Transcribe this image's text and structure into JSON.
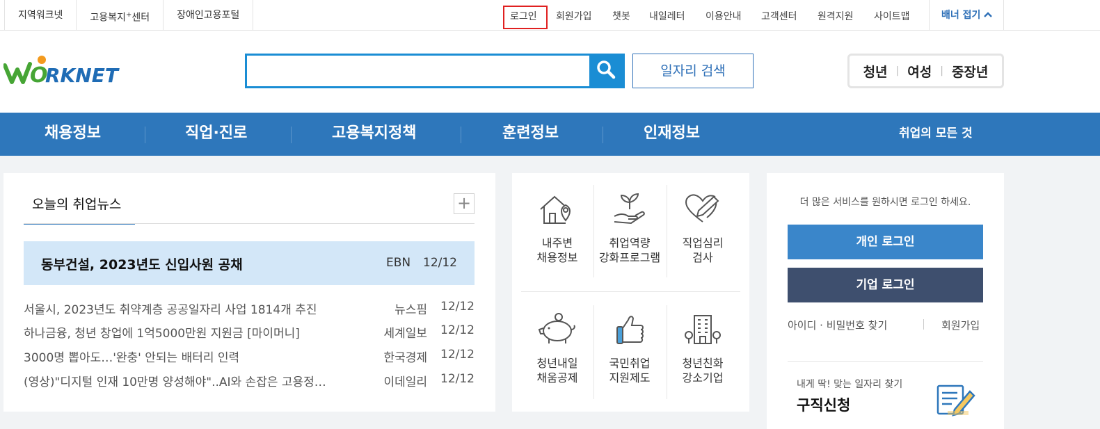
{
  "topbar": {
    "left_links": [
      "지역워크넷",
      "고용복지",
      "장애인고용포털"
    ],
    "welfare_sup": "+",
    "welfare_suffix": "센터",
    "right_links": {
      "login": "로그인",
      "signup": "회원가입",
      "chatbot": "챗봇",
      "letter": "내일레터",
      "guide": "이용안내",
      "support": "고객센터",
      "remote": "원격지원",
      "sitemap": "사이트맵"
    },
    "banner_fold": "배너 접기"
  },
  "header": {
    "logo_text": "WORKNET",
    "search_placeholder": "",
    "job_search": "일자리 검색",
    "targets": [
      "청년",
      "여성",
      "중장년"
    ]
  },
  "nav": {
    "items": [
      "채용정보",
      "직업·진로",
      "고용복지정책",
      "훈련정보",
      "인재정보"
    ],
    "all": "취업의 모든 것"
  },
  "news": {
    "tab": "오늘의 취업뉴스",
    "plus": "+",
    "headline": {
      "title": "동부건설, 2023년도 신입사원 공채",
      "source": "EBN",
      "date": "12/12"
    },
    "items": [
      {
        "title": "서울시, 2023년도 취약계층 공공일자리 사업 1814개 추진",
        "source": "뉴스핌",
        "date": "12/12"
      },
      {
        "title": "하나금융, 청년 창업에 1억5000만원 지원금 [마이머니]",
        "source": "세계일보",
        "date": "12/12"
      },
      {
        "title": "3000명 뽑아도…'완충' 안되는 배터리 인력",
        "source": "한국경제",
        "date": "12/12"
      },
      {
        "title": "(영상)\"디지털 인재 10만명 양성해야\"..AI와 손잡은 고용정…",
        "source": "이데일리",
        "date": "12/12"
      }
    ]
  },
  "services": {
    "items": [
      {
        "line1": "내주변",
        "line2": "채용정보",
        "icon": "house-pin-icon"
      },
      {
        "line1": "취업역량",
        "line2": "강화프로그램",
        "icon": "sprout-hand-icon"
      },
      {
        "line1": "직업심리",
        "line2": "검사",
        "icon": "heart-pencil-icon"
      },
      {
        "line1": "청년내일",
        "line2": "채움공제",
        "icon": "piggy-bank-icon"
      },
      {
        "line1": "국민취업",
        "line2": "지원제도",
        "icon": "thumbs-up-icon"
      },
      {
        "line1": "청년친화",
        "line2": "강소기업",
        "icon": "building-icon"
      }
    ]
  },
  "login_panel": {
    "message": "더 많은 서비스를 원하시면 로그인 하세요.",
    "personal_login": "개인 로그인",
    "company_login": "기업 로그인",
    "find_account": "아이디 · 비밀번호 찾기",
    "join": "회원가입",
    "apply_sub": "내게 딱! 맞는 일자리 찾기",
    "apply_title": "구직신청"
  },
  "colors": {
    "nav_blue": "#2e77bb",
    "search_blue": "#1a8dd4",
    "headline_bg": "#d3e7f8",
    "company_login": "#3e4f6e",
    "login_highlight": "#e02020"
  }
}
